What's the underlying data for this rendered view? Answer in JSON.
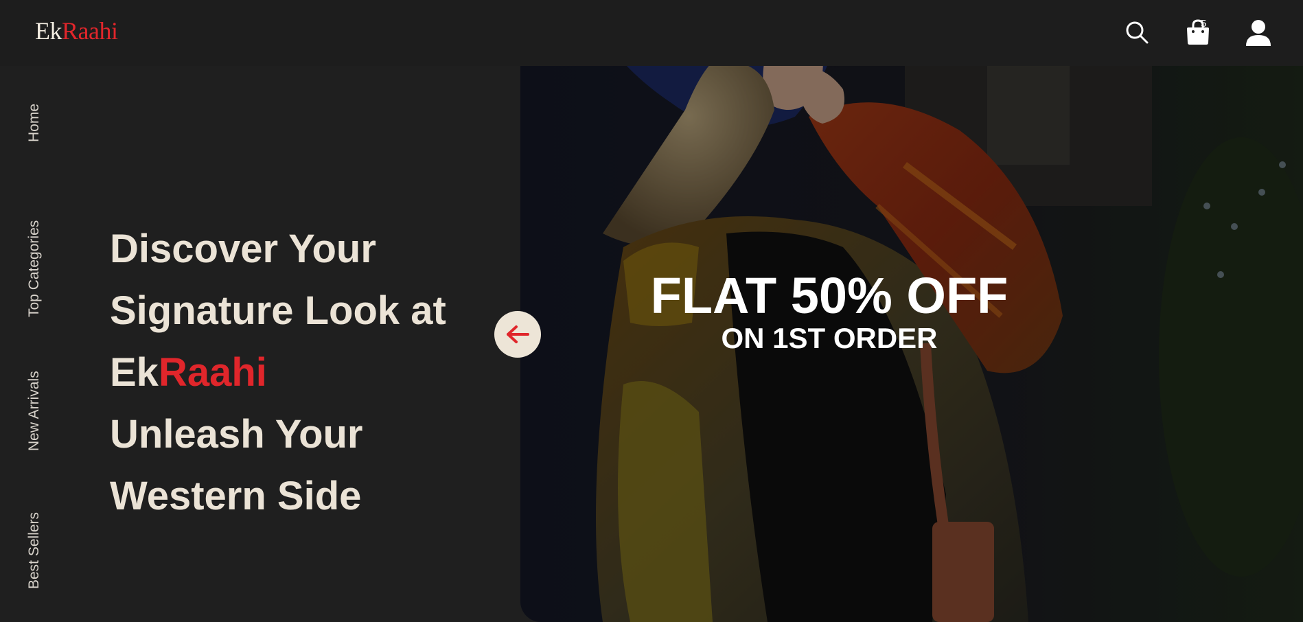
{
  "brand": {
    "part1": "Ek",
    "part2": "Raahi"
  },
  "header": {
    "cart_count": "5"
  },
  "nav": {
    "items": [
      "Home",
      "Top Categories",
      "New Arrivals",
      "Best Sellers"
    ]
  },
  "hero": {
    "line1": "Discover Your",
    "line2": "Signature Look at",
    "brand_ek": "Ek",
    "brand_raahi": "Raahi",
    "line4": "Unleash Your",
    "line5": "Western Side"
  },
  "promo": {
    "headline": "FLAT 50% OFF",
    "subline": "ON 1ST ORDER"
  },
  "icons": {
    "search": "search-icon",
    "cart": "shopping-bag-icon",
    "user": "user-icon",
    "arrow": "arrow-left-icon"
  },
  "colors": {
    "background": "#1f1f1f",
    "accent_red": "#e0262b",
    "cream": "#ebe3d6"
  }
}
